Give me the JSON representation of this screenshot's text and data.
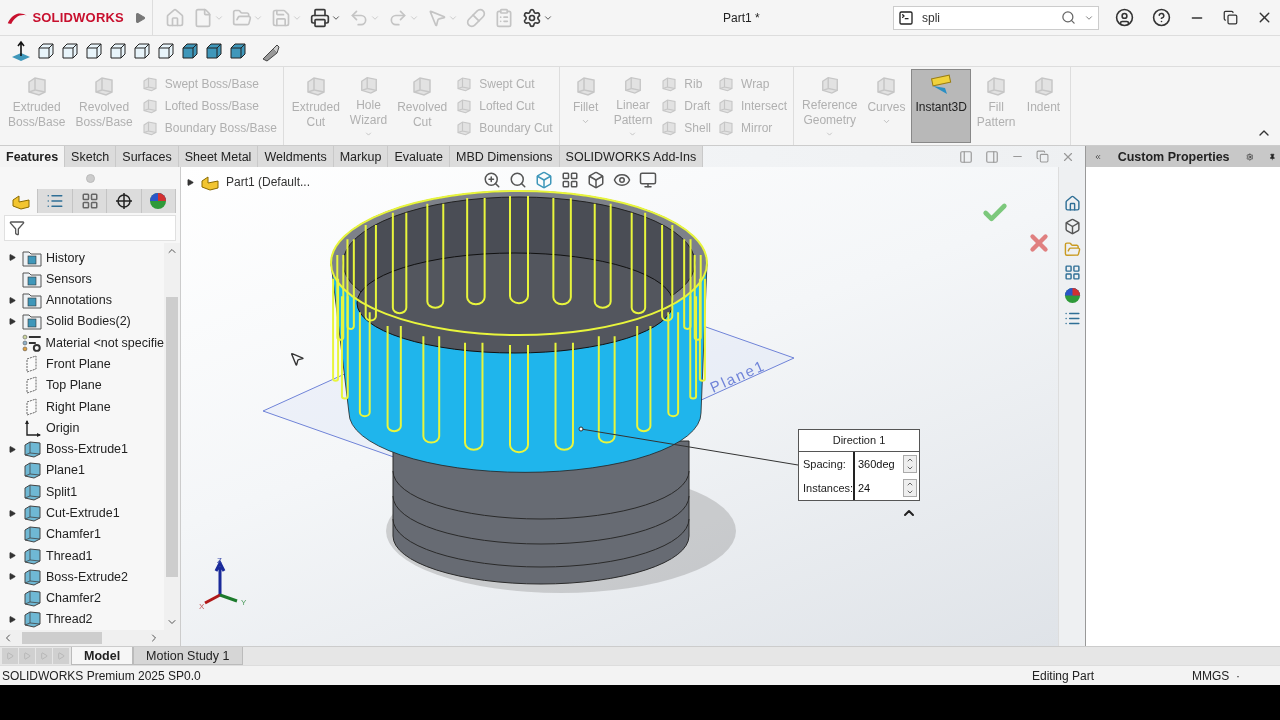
{
  "title_bar": {
    "brand": "SOLIDWORKS",
    "document": "Part1 *",
    "search": {
      "value": "spli"
    },
    "quick_access": [
      {
        "disabled": true,
        "dropdown": false
      },
      {
        "disabled": true,
        "dropdown": true
      },
      {
        "disabled": true,
        "dropdown": true
      },
      {
        "disabled": true,
        "dropdown": true
      },
      {
        "disabled": false,
        "dropdown": true
      },
      {
        "disabled": true,
        "dropdown": true
      },
      {
        "disabled": true,
        "dropdown": true
      },
      {
        "disabled": true,
        "dropdown": true
      },
      {
        "disabled": true,
        "dropdown": false
      },
      {
        "disabled": true,
        "dropdown": false
      },
      {
        "disabled": false,
        "dropdown": true
      }
    ]
  },
  "ribbon": {
    "groups": [
      {
        "items": [
          {
            "kind": "large",
            "label": "Extruded\nBoss/Base",
            "disabled": true,
            "selected": false,
            "dropdown": false
          },
          {
            "kind": "large",
            "label": "Revolved\nBoss/Base",
            "disabled": true,
            "selected": false,
            "dropdown": false
          },
          {
            "kind": "stack",
            "items": [
              {
                "label": "Swept Boss/Base",
                "disabled": true
              },
              {
                "label": "Lofted Boss/Base",
                "disabled": true
              },
              {
                "label": "Boundary Boss/Base",
                "disabled": true
              }
            ]
          }
        ]
      },
      {
        "items": [
          {
            "kind": "large",
            "label": "Extruded\nCut",
            "disabled": true,
            "selected": false,
            "dropdown": false
          },
          {
            "kind": "large",
            "label": "Hole\nWizard",
            "disabled": true,
            "selected": false,
            "dropdown": true
          },
          {
            "kind": "large",
            "label": "Revolved\nCut",
            "disabled": true,
            "selected": false,
            "dropdown": false
          },
          {
            "kind": "stack",
            "items": [
              {
                "label": "Swept Cut",
                "disabled": true
              },
              {
                "label": "Lofted Cut",
                "disabled": true
              },
              {
                "label": "Boundary Cut",
                "disabled": true
              }
            ]
          }
        ]
      },
      {
        "items": [
          {
            "kind": "large",
            "label": "Fillet",
            "disabled": true,
            "selected": false,
            "dropdown": true
          },
          {
            "kind": "large",
            "label": "Linear\nPattern",
            "disabled": true,
            "selected": false,
            "dropdown": true
          },
          {
            "kind": "stack",
            "items": [
              {
                "label": "Rib",
                "disabled": true
              },
              {
                "label": "Draft",
                "disabled": true
              },
              {
                "label": "Shell",
                "disabled": true
              }
            ]
          },
          {
            "kind": "stack",
            "items": [
              {
                "label": "Wrap",
                "disabled": true
              },
              {
                "label": "Intersect",
                "disabled": true
              },
              {
                "label": "Mirror",
                "disabled": true
              }
            ]
          }
        ]
      },
      {
        "items": [
          {
            "kind": "large",
            "label": "Reference\nGeometry",
            "disabled": true,
            "selected": false,
            "dropdown": true
          },
          {
            "kind": "large",
            "label": "Curves",
            "disabled": true,
            "selected": false,
            "dropdown": true
          },
          {
            "kind": "large",
            "label": "Instant3D",
            "disabled": false,
            "selected": true,
            "dropdown": false
          },
          {
            "kind": "large",
            "label": "Fill\nPattern",
            "disabled": true,
            "selected": false,
            "dropdown": false
          },
          {
            "kind": "large",
            "label": "Indent",
            "disabled": true,
            "selected": false,
            "dropdown": false
          }
        ]
      }
    ]
  },
  "command_tabs": [
    {
      "label": "Features",
      "selected": true
    },
    {
      "label": "Sketch",
      "selected": false
    },
    {
      "label": "Surfaces",
      "selected": false
    },
    {
      "label": "Sheet Metal",
      "selected": false
    },
    {
      "label": "Weldments",
      "selected": false
    },
    {
      "label": "Markup",
      "selected": false
    },
    {
      "label": "Evaluate",
      "selected": false
    },
    {
      "label": "MBD Dimensions",
      "selected": false
    },
    {
      "label": "SOLIDWORKS Add-Ins",
      "selected": false
    }
  ],
  "task_pane": {
    "title": "Custom Properties"
  },
  "feature_manager": {
    "panel_tabs": [
      {
        "selected": true
      },
      {
        "selected": false
      },
      {
        "selected": false
      },
      {
        "selected": false
      },
      {
        "selected": false
      }
    ],
    "tree": [
      {
        "label": "History",
        "kind": "folder",
        "has_children": true
      },
      {
        "label": "Sensors",
        "kind": "folder",
        "has_children": false
      },
      {
        "label": "Annotations",
        "kind": "folder",
        "has_children": true
      },
      {
        "label": "Solid Bodies(2)",
        "kind": "folder",
        "has_children": true
      },
      {
        "label": "Material <not specifie",
        "kind": "material",
        "has_children": false
      },
      {
        "label": "Front Plane",
        "kind": "plane",
        "has_children": false
      },
      {
        "label": "Top Plane",
        "kind": "plane",
        "has_children": false
      },
      {
        "label": "Right Plane",
        "kind": "plane",
        "has_children": false
      },
      {
        "label": "Origin",
        "kind": "origin",
        "has_children": false
      },
      {
        "label": "Boss-Extrude1",
        "kind": "feature",
        "has_children": true
      },
      {
        "label": "Plane1",
        "kind": "feature",
        "has_children": false
      },
      {
        "label": "Split1",
        "kind": "feature",
        "has_children": false
      },
      {
        "label": "Cut-Extrude1",
        "kind": "feature",
        "has_children": true
      },
      {
        "label": "Chamfer1",
        "kind": "feature",
        "has_children": false
      },
      {
        "label": "Thread1",
        "kind": "feature",
        "has_children": true
      },
      {
        "label": "Boss-Extrude2",
        "kind": "feature",
        "has_children": true
      },
      {
        "label": "Chamfer2",
        "kind": "feature",
        "has_children": false
      },
      {
        "label": "Thread2",
        "kind": "feature",
        "has_children": true
      }
    ]
  },
  "viewport": {
    "breadcrumb": "Part1 (Default...",
    "plane_label": "Plane1",
    "triad": {
      "x": "X",
      "y": "Y",
      "z": "Z"
    },
    "callout": {
      "title": "Direction 1",
      "fields": [
        {
          "label": "Spacing:",
          "value": "360deg"
        },
        {
          "label": "Instances:",
          "value": "24"
        }
      ]
    }
  },
  "bottom_tabs": [
    {
      "label": "Model",
      "selected": true
    },
    {
      "label": "Motion Study 1",
      "selected": false
    }
  ],
  "status_bar": {
    "product": "SOLIDWORKS Premium 2025 SP0.0",
    "mode": "Editing Part",
    "units": "MMGS",
    "separator": "·"
  }
}
